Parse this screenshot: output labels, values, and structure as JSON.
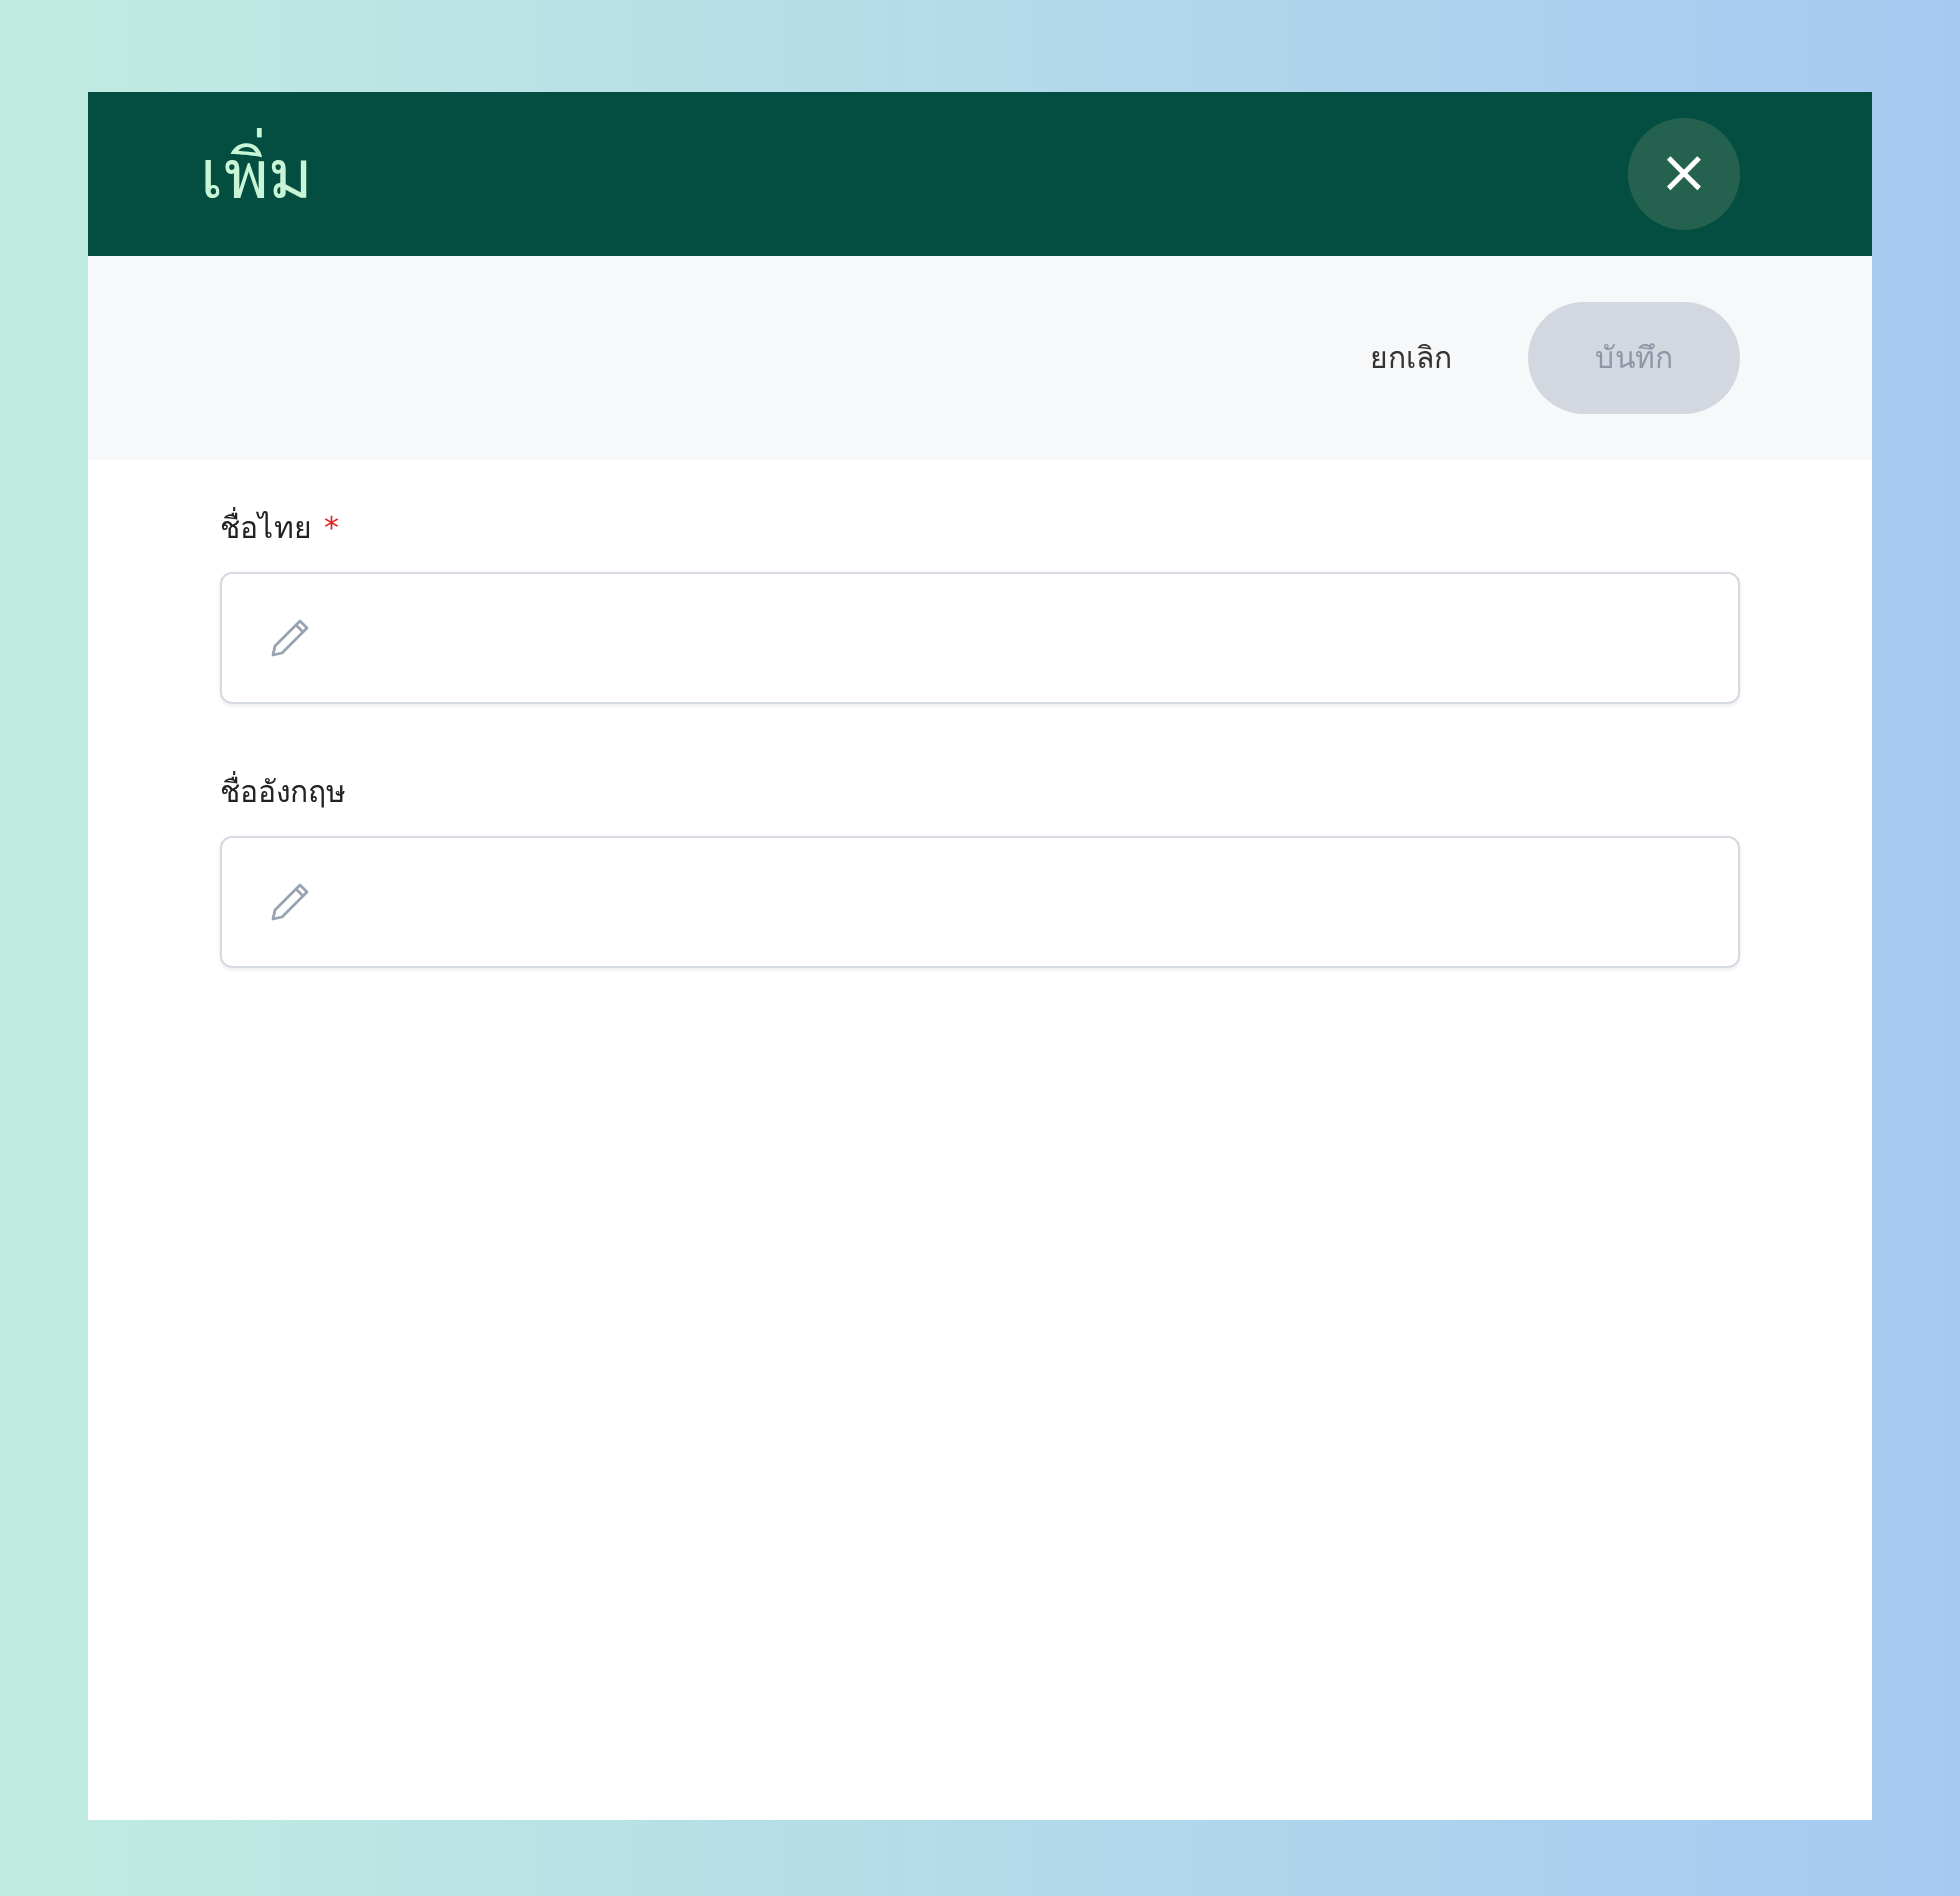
{
  "dialog": {
    "title": "เพิ่ม",
    "close_label": "×"
  },
  "actions": {
    "cancel": {
      "label": "ยกเลิก"
    },
    "save": {
      "label": "บันทึก",
      "disabled": true
    }
  },
  "fields": [
    {
      "label": "ชื่อไทย",
      "required_mark": "*"
    },
    {
      "label": "ชื่ออังกฤษ"
    }
  ]
}
